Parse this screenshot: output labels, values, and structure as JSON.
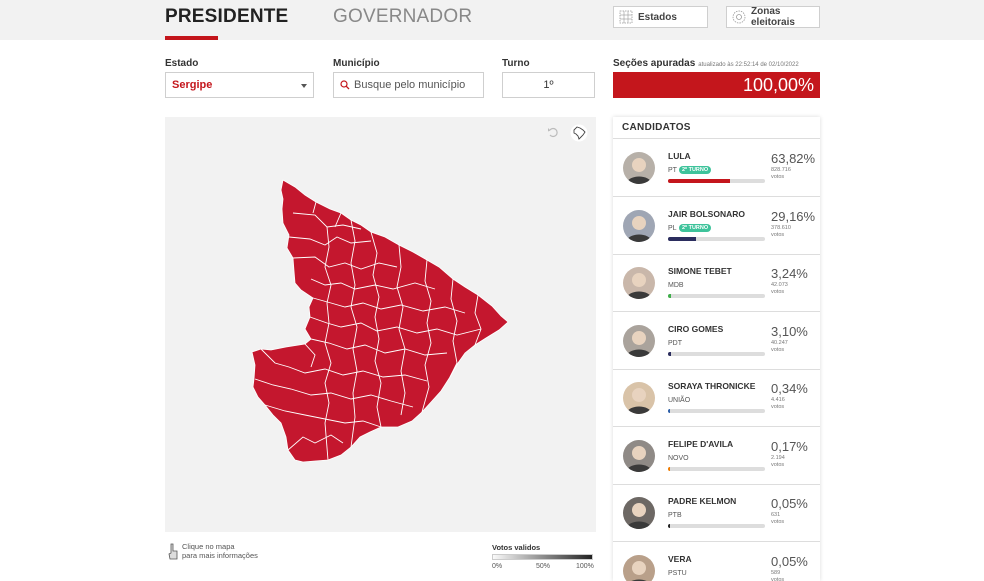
{
  "tabs": {
    "presidente": "PRESIDENTE",
    "governador": "GOVERNADOR"
  },
  "header_buttons": {
    "estados": "Estados",
    "zonas": "Zonas eleitorais"
  },
  "filters": {
    "estado_label": "Estado",
    "estado_value": "Sergipe",
    "municipio_label": "Município",
    "municipio_placeholder": "Busque pelo município",
    "turno_label": "Turno",
    "turno_value": "1º",
    "secoes_label": "Seções apuradas",
    "secoes_updated": "atualizado às 22:52:14 de 02/10/2022",
    "secoes_value": "100,00%"
  },
  "map": {
    "state": "Sergipe",
    "fill_color": "#c4172e",
    "hint_line1": "Clique no mapa",
    "hint_line2": "para mais informações",
    "legend_title": "Votos validos",
    "legend_min": "0%",
    "legend_mid": "50%",
    "legend_max": "100%"
  },
  "candidates_title": "CANDIDATOS",
  "candidates": [
    {
      "name": "LULA",
      "party": "PT",
      "badge": "2º TURNO",
      "pct": "63,82%",
      "votes": "828.716",
      "votes_label": "votos",
      "share": 0.638,
      "bar_color": "#c4161c",
      "avatar_bg": "#b7b0a8"
    },
    {
      "name": "JAIR BOLSONARO",
      "party": "PL",
      "badge": "2º TURNO",
      "pct": "29,16%",
      "votes": "378.610",
      "votes_label": "votos",
      "share": 0.292,
      "bar_color": "#2b2d5e",
      "avatar_bg": "#9fa6b4"
    },
    {
      "name": "SIMONE TEBET",
      "party": "MDB",
      "badge": "",
      "pct": "3,24%",
      "votes": "42.073",
      "votes_label": "votos",
      "share": 0.032,
      "bar_color": "#3fae4a",
      "avatar_bg": "#c9b7aa"
    },
    {
      "name": "CIRO GOMES",
      "party": "PDT",
      "badge": "",
      "pct": "3,10%",
      "votes": "40.247",
      "votes_label": "votos",
      "share": 0.031,
      "bar_color": "#2b2d5e",
      "avatar_bg": "#aaa39c"
    },
    {
      "name": "SORAYA THRONICKE",
      "party": "UNIÃO",
      "badge": "",
      "pct": "0,34%",
      "votes": "4.416",
      "votes_label": "votos",
      "share": 0.0034,
      "bar_color": "#2b5ea8",
      "avatar_bg": "#d9c3a8"
    },
    {
      "name": "FELIPE D'AVILA",
      "party": "NOVO",
      "badge": "",
      "pct": "0,17%",
      "votes": "2.194",
      "votes_label": "votos",
      "share": 0.0017,
      "bar_color": "#f07c00",
      "avatar_bg": "#8f8a86"
    },
    {
      "name": "PADRE KELMON",
      "party": "PTB",
      "badge": "",
      "pct": "0,05%",
      "votes": "631",
      "votes_label": "votos",
      "share": 0.0005,
      "bar_color": "#222",
      "avatar_bg": "#6d6864"
    },
    {
      "name": "VERA",
      "party": "PSTU",
      "badge": "",
      "pct": "0,05%",
      "votes": "589",
      "votes_label": "votos",
      "share": 0.0005,
      "bar_color": "#c4161c",
      "avatar_bg": "#b9a08a"
    }
  ],
  "colors": {
    "accent": "#c4161c",
    "second_round_badge": "#3ec39b"
  },
  "icons": {
    "estados": "grid-icon",
    "zonas": "zones-icon",
    "search": "search-icon",
    "dropdown": "chevron-down-icon",
    "reset": "undo-icon",
    "brazil": "brazil-map-icon",
    "hint": "hand-pointer-icon"
  }
}
